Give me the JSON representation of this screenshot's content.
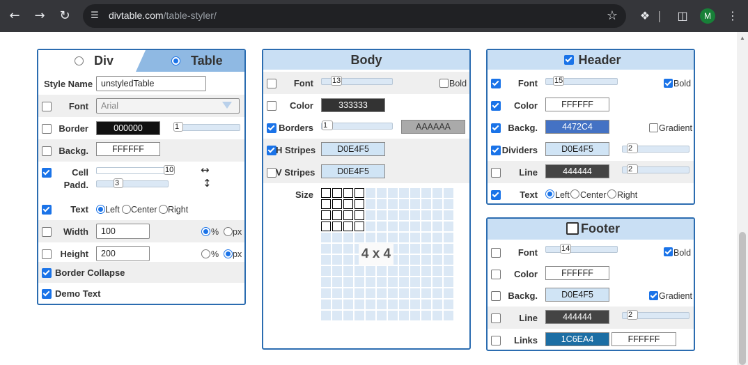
{
  "browser": {
    "url_host": "divtable.com",
    "url_path": "/table-styler/",
    "profile_initial": "M",
    "icons": {
      "back": "arrow-left-icon",
      "forward": "arrow-right-icon",
      "reload": "reload-icon",
      "site": "tune-icon",
      "bookmark": "star-icon",
      "extensions": "puzzle-icon",
      "sidepanel": "side-panel-icon",
      "menu": "kebab-menu-icon"
    }
  },
  "table_panel": {
    "tabs": [
      "Div",
      "Table"
    ],
    "selected_tab": "Table",
    "style_name_label": "Style Name",
    "style_name_value": "unstyledTable",
    "font_label": "Font",
    "font_value": "Arial",
    "border_label": "Border",
    "border_color": "000000",
    "border_width": "1",
    "backg_label": "Backg.",
    "backg_color": "FFFFFF",
    "cell_label": "Cell",
    "padd_label": "Padd.",
    "cell_spacing": "10",
    "cell_padding": "3",
    "text_label": "Text",
    "align_options": [
      "Left",
      "Center",
      "Right"
    ],
    "width_label": "Width",
    "width_value": "100",
    "width_unit": "%",
    "height_label": "Height",
    "height_value": "200",
    "height_unit": "px",
    "unit_options": [
      "%",
      "px"
    ],
    "border_collapse_label": "Border Collapse",
    "demo_text_label": "Demo Text"
  },
  "body_panel": {
    "title": "Body",
    "font_label": "Font",
    "font_size": "13",
    "bold_label": "Bold",
    "color_label": "Color",
    "color_value": "333333",
    "borders_label": "Borders",
    "borders_width": "1",
    "borders_color": "AAAAAA",
    "hstripes_label": "H Stripes",
    "hstripes_color": "D0E4F5",
    "vstripes_label": "V Stripes",
    "vstripes_color": "D0E4F5",
    "size_label": "Size",
    "size_value": "4 x 4"
  },
  "header_panel": {
    "title": "Header",
    "font_label": "Font",
    "font_size": "15",
    "bold_label": "Bold",
    "color_label": "Color",
    "color_value": "FFFFFF",
    "backg_label": "Backg.",
    "backg_value": "4472C4",
    "gradient_label": "Gradient",
    "dividers_label": "Dividers",
    "dividers_color": "D0E4F5",
    "dividers_width": "2",
    "line_label": "Line",
    "line_color": "444444",
    "line_width": "2",
    "text_label": "Text",
    "align_options": [
      "Left",
      "Center",
      "Right"
    ]
  },
  "footer_panel": {
    "title": "Footer",
    "font_label": "Font",
    "font_size": "14",
    "bold_label": "Bold",
    "color_label": "Color",
    "color_value": "FFFFFF",
    "backg_label": "Backg.",
    "backg_value": "D0E4F5",
    "gradient_label": "Gradient",
    "line_label": "Line",
    "line_color": "444444",
    "line_width": "2",
    "links_label": "Links",
    "links_color": "1C6EA4",
    "links_bg": "FFFFFF"
  },
  "colors": {
    "accent": "#2b6cb0",
    "title_bg": "#c9dff4",
    "checkbox": "#1a73e8"
  }
}
